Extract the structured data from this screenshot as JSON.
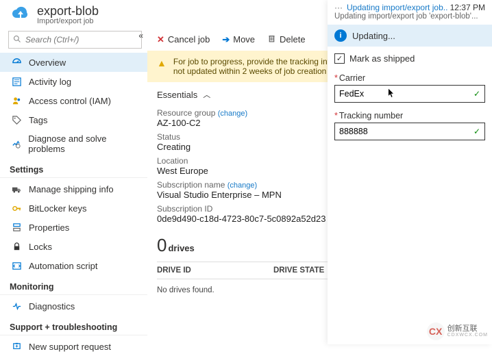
{
  "header": {
    "title": "export-blob",
    "subtitle": "Import/export job"
  },
  "notification": {
    "dots": "···",
    "link_text": "Updating import/export job..",
    "time": "12:37 PM",
    "desc": "Updating import/export job 'export-blob'..."
  },
  "updating_bar": {
    "label": "Updating..."
  },
  "sidebar": {
    "search_placeholder": "Search (Ctrl+/)",
    "items_top": [
      {
        "icon": "overview-icon",
        "label": "Overview",
        "active": true
      },
      {
        "icon": "activitylog-icon",
        "label": "Activity log"
      },
      {
        "icon": "iam-icon",
        "label": "Access control (IAM)"
      },
      {
        "icon": "tags-icon",
        "label": "Tags"
      },
      {
        "icon": "diagnose-icon",
        "label": "Diagnose and solve problems"
      }
    ],
    "section_settings": "Settings",
    "items_settings": [
      {
        "icon": "shipping-icon",
        "label": "Manage shipping info"
      },
      {
        "icon": "bitlocker-icon",
        "label": "BitLocker keys"
      },
      {
        "icon": "properties-icon",
        "label": "Properties"
      },
      {
        "icon": "locks-icon",
        "label": "Locks"
      },
      {
        "icon": "automation-icon",
        "label": "Automation script"
      }
    ],
    "section_monitoring": "Monitoring",
    "items_monitoring": [
      {
        "icon": "diagnostics-icon",
        "label": "Diagnostics"
      }
    ],
    "section_support": "Support + troubleshooting",
    "items_support": [
      {
        "icon": "support-icon",
        "label": "New support request"
      }
    ]
  },
  "toolbar": {
    "cancel": "Cancel job",
    "move": "Move",
    "delete": "Delete"
  },
  "warning": "For job to progress, provide the tracking information. The job will expire if tracking is not updated within 2 weeks of job creation",
  "essentials": {
    "header": "Essentials",
    "rg_label": "Resource group",
    "rg_change": "(change)",
    "rg_value": "AZ-100-C2",
    "status_label": "Status",
    "status_value": "Creating",
    "location_label": "Location",
    "location_value": "West Europe",
    "sub_label": "Subscription name",
    "sub_change": "(change)",
    "sub_value": "Visual Studio Enterprise – MPN",
    "subid_label": "Subscription ID",
    "subid_value": "0de9d490-c18d-4723-80c7-5c0892a52d23"
  },
  "drives": {
    "count": "0",
    "word": "drives",
    "col1": "DRIVE ID",
    "col2": "DRIVE STATE",
    "empty": "No drives found."
  },
  "form": {
    "mark_shipped": "Mark as shipped",
    "carrier_label": "Carrier",
    "carrier_value": "FedEx",
    "tracking_label": "Tracking number",
    "tracking_value": "888888"
  },
  "watermark": {
    "brand": "创新互联",
    "sub": "CDXWCX.COM"
  }
}
